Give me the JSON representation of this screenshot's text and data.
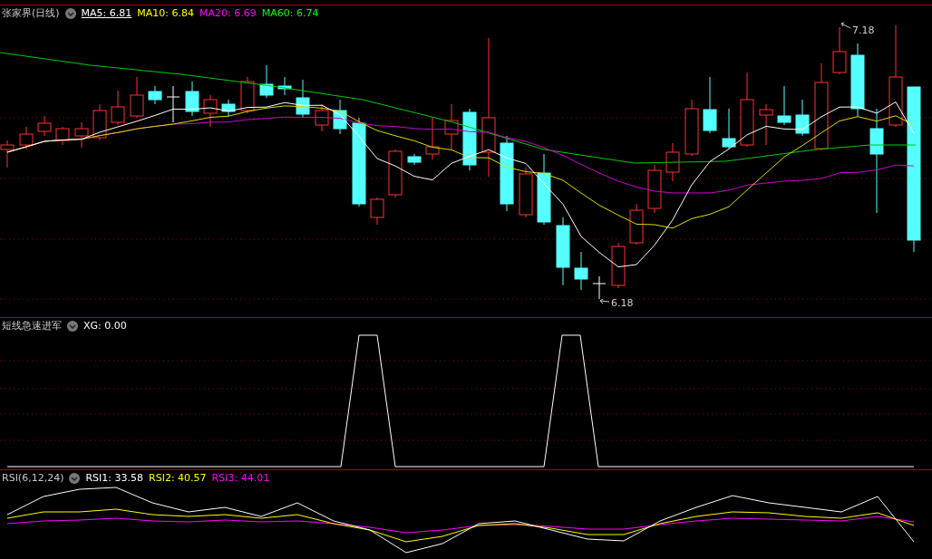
{
  "main_panel": {
    "title": "张家界(日线)",
    "indicators": [
      {
        "label": "MA5: 6.81",
        "color": "#ffffff",
        "selected": true
      },
      {
        "label": "MA10: 6.84",
        "color": "#ffff00",
        "selected": false
      },
      {
        "label": "MA20: 6.69",
        "color": "#ff00ff",
        "selected": false
      },
      {
        "label": "MA60: 6.74",
        "color": "#00ff00",
        "selected": false
      }
    ],
    "high_label": "7.18",
    "low_label": "6.18"
  },
  "signal_panel": {
    "title": "短线急速进军",
    "indicators": [
      {
        "label": "XG: 0.00",
        "color": "#ffffff"
      }
    ]
  },
  "rsi_panel": {
    "title": "RSI(6,12,24)",
    "indicators": [
      {
        "label": "RSI1: 33.58",
        "color": "#ffffff"
      },
      {
        "label": "RSI2: 40.57",
        "color": "#ffff00"
      },
      {
        "label": "RSI3: 44.01",
        "color": "#ff00ff"
      }
    ]
  }
}
